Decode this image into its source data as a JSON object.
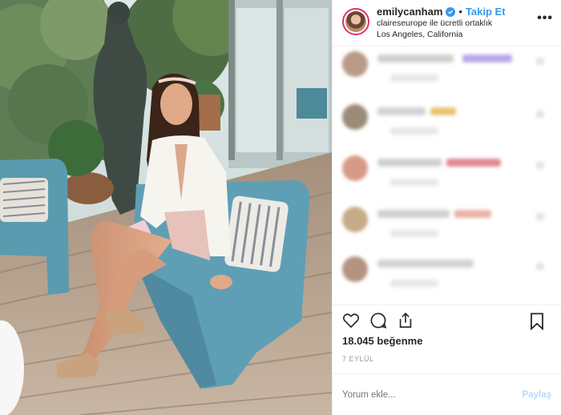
{
  "header": {
    "username": "emilycanham",
    "separator": "•",
    "follow_label": "Takip Et",
    "partnership": "claireseurope ile ücretli ortaklık",
    "location": "Los Angeles, California",
    "more_label": "•••"
  },
  "post": {
    "likes": "18.045 beğenme",
    "date": "7 EYLÜL"
  },
  "comment_box": {
    "placeholder": "Yorum ekle...",
    "post_label": "Paylaş"
  },
  "colors": {
    "accent": "#3897f0",
    "chair": "#5b9bb0"
  },
  "icons": [
    "verified-badge-icon",
    "more-icon",
    "heart-icon",
    "comment-icon",
    "share-icon",
    "bookmark-icon"
  ]
}
